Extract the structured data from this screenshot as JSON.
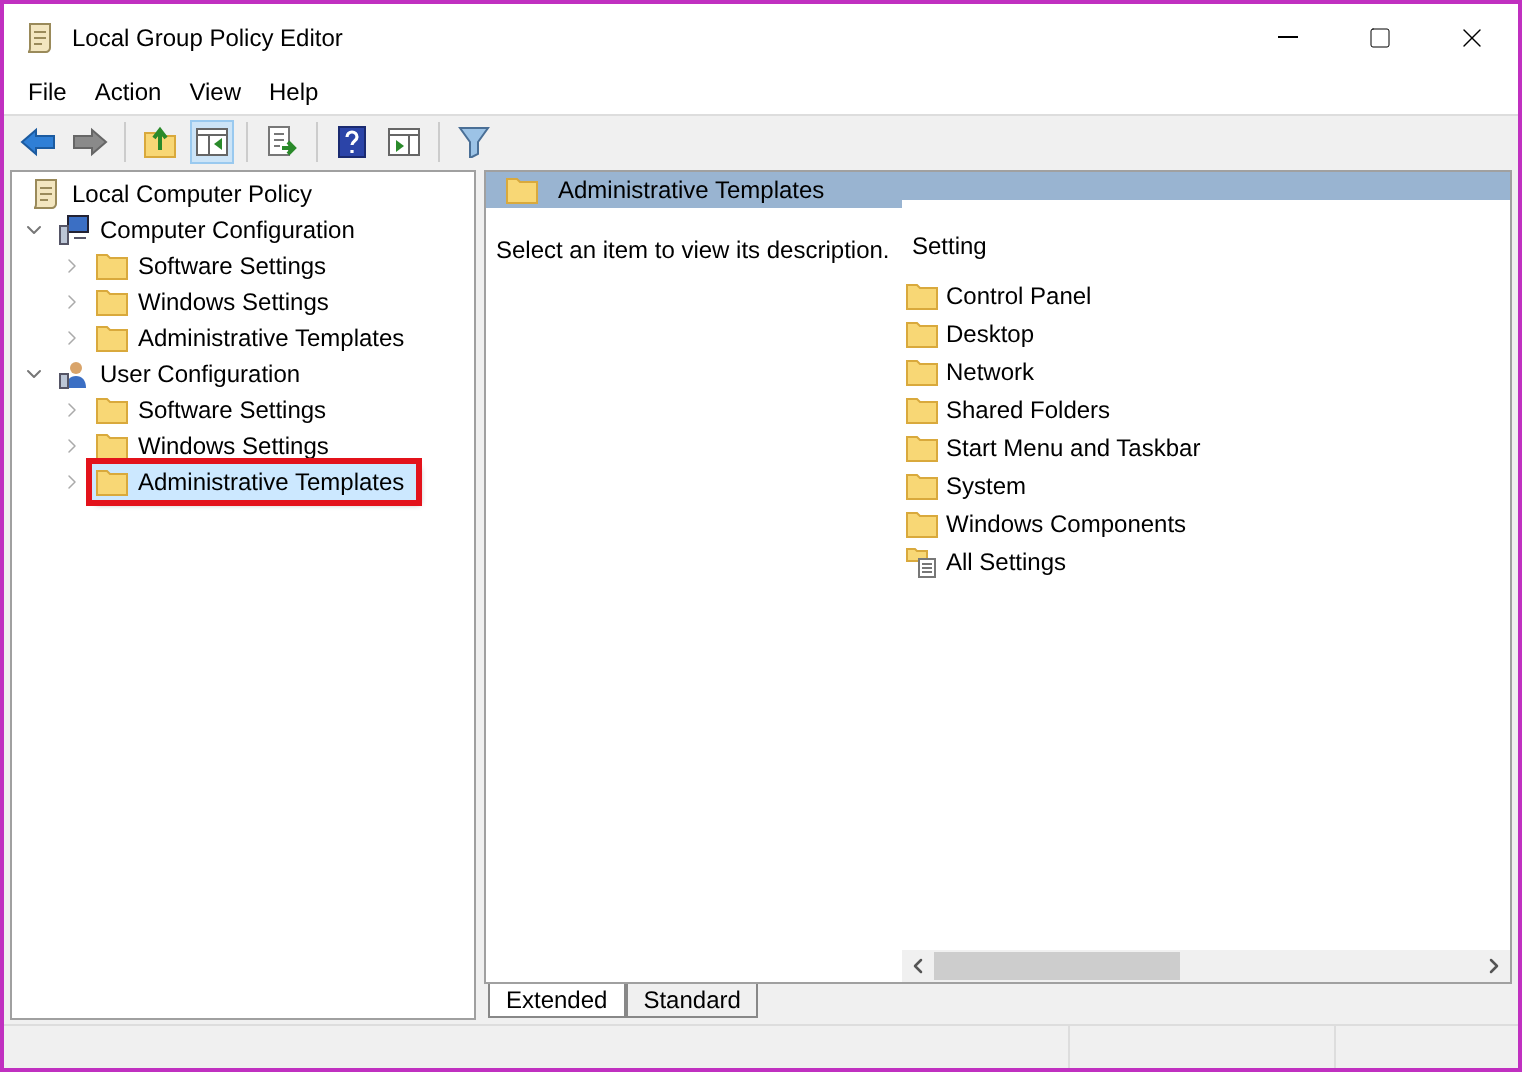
{
  "window": {
    "title": "Local Group Policy Editor"
  },
  "menu": [
    "File",
    "Action",
    "View",
    "Help"
  ],
  "toolbar": [
    {
      "kind": "back",
      "active": false
    },
    {
      "kind": "forward",
      "active": false
    },
    {
      "kind": "sep"
    },
    {
      "kind": "up",
      "active": false
    },
    {
      "kind": "tree",
      "active": true
    },
    {
      "kind": "sep"
    },
    {
      "kind": "export",
      "active": false
    },
    {
      "kind": "sep"
    },
    {
      "kind": "help",
      "active": false
    },
    {
      "kind": "pane",
      "active": false
    },
    {
      "kind": "sep"
    },
    {
      "kind": "filter",
      "active": false
    }
  ],
  "tree": [
    {
      "label": "Local Computer Policy",
      "kind": "policy",
      "selected": false,
      "children": [
        {
          "label": "Computer Configuration",
          "kind": "computer",
          "expanded": true,
          "selected": false,
          "children": [
            {
              "label": "Software Settings",
              "kind": "folder",
              "expanded": false,
              "selected": false
            },
            {
              "label": "Windows Settings",
              "kind": "folder",
              "expanded": false,
              "selected": false
            },
            {
              "label": "Administrative Templates",
              "kind": "folder",
              "expanded": false,
              "selected": false
            }
          ]
        },
        {
          "label": "User Configuration",
          "kind": "user",
          "expanded": true,
          "selected": false,
          "children": [
            {
              "label": "Software Settings",
              "kind": "folder",
              "expanded": false,
              "selected": false
            },
            {
              "label": "Windows Settings",
              "kind": "folder",
              "expanded": false,
              "selected": false
            },
            {
              "label": "Administrative Templates",
              "kind": "folder",
              "expanded": false,
              "selected": true
            }
          ]
        }
      ]
    }
  ],
  "details": {
    "header": "Administrative Templates",
    "description": "Select an item to view its description.",
    "column": "Setting",
    "items": [
      {
        "label": "Control Panel",
        "kind": "folder"
      },
      {
        "label": "Desktop",
        "kind": "folder"
      },
      {
        "label": "Network",
        "kind": "folder"
      },
      {
        "label": "Shared Folders",
        "kind": "folder"
      },
      {
        "label": "Start Menu and Taskbar",
        "kind": "folder"
      },
      {
        "label": "System",
        "kind": "folder"
      },
      {
        "label": "Windows Components",
        "kind": "folder"
      },
      {
        "label": "All Settings",
        "kind": "settings"
      }
    ]
  },
  "tabs": [
    {
      "label": "Extended",
      "selected": true
    },
    {
      "label": "Standard",
      "selected": false
    }
  ]
}
